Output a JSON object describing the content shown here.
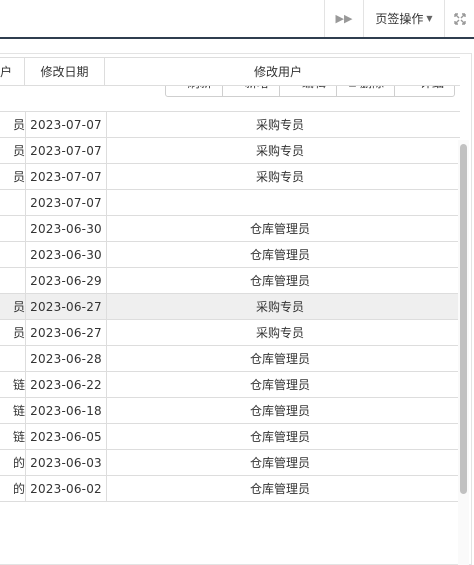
{
  "topbar": {
    "next_icon": "double-chevron-right-icon",
    "tab_ops_label": "页签操作",
    "fullscreen_icon": "fullscreen-icon"
  },
  "toolbar": {
    "refresh": "刷新",
    "add": "新增",
    "edit": "编辑",
    "delete": "删除",
    "detail": "详细"
  },
  "table": {
    "headers": {
      "col1": "户",
      "col2": "修改日期",
      "col3": "修改用户"
    },
    "rows": [
      {
        "c1": "员",
        "date": "2023-07-07",
        "user": "采购专员"
      },
      {
        "c1": "员",
        "date": "2023-07-07",
        "user": "采购专员"
      },
      {
        "c1": "员",
        "date": "2023-07-07",
        "user": "采购专员"
      },
      {
        "c1": "",
        "date": "2023-07-07",
        "user": ""
      },
      {
        "c1": "",
        "date": "2023-06-30",
        "user": "仓库管理员"
      },
      {
        "c1": "",
        "date": "2023-06-30",
        "user": "仓库管理员"
      },
      {
        "c1": "",
        "date": "2023-06-29",
        "user": "仓库管理员"
      },
      {
        "c1": "员",
        "date": "2023-06-27",
        "user": "采购专员"
      },
      {
        "c1": "员",
        "date": "2023-06-27",
        "user": "采购专员"
      },
      {
        "c1": "",
        "date": "2023-06-28",
        "user": "仓库管理员"
      },
      {
        "c1": "链",
        "date": "2023-06-22",
        "user": "仓库管理员"
      },
      {
        "c1": "链",
        "date": "2023-06-18",
        "user": "仓库管理员"
      },
      {
        "c1": "链",
        "date": "2023-06-05",
        "user": "仓库管理员"
      },
      {
        "c1": "的",
        "date": "2023-06-03",
        "user": "仓库管理员"
      },
      {
        "c1": "的",
        "date": "2023-06-02",
        "user": "仓库管理员"
      }
    ]
  }
}
